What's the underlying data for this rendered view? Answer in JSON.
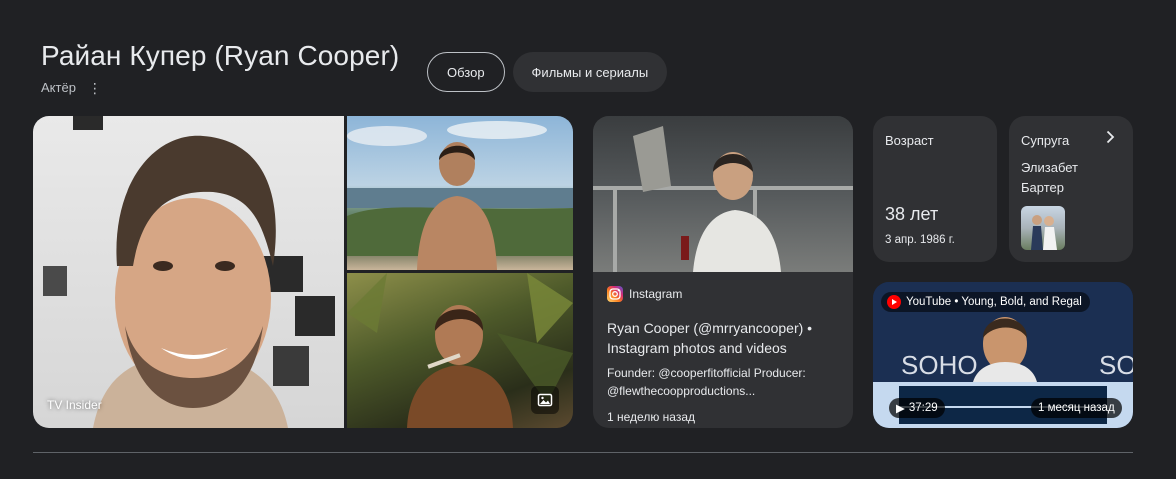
{
  "header": {
    "title": "Райан Купер (Ryan Cooper)",
    "subtitle": "Актёр",
    "more_icon": "more-vert-icon"
  },
  "tabs": [
    {
      "label": "Обзор",
      "active": true
    },
    {
      "label": "Фильмы и сериалы",
      "active": false
    }
  ],
  "photos": {
    "main_caption": "TV Insider",
    "images_icon": "image-icon"
  },
  "instagram": {
    "source": "Instagram",
    "title": "Ryan Cooper (@mrryancooper) • Instagram photos and videos",
    "description": "Founder: @cooperfitofficial Producer: @flewthecoopproductions...",
    "date": "1 неделю назад"
  },
  "facts": {
    "age": {
      "label": "Возраст",
      "value": "38 лет",
      "date": "3 апр. 1986 г."
    },
    "spouse": {
      "label": "Супруга",
      "name": "Элизабет Бартер",
      "icon": "chevron-right-icon"
    }
  },
  "video": {
    "source": "YouTube • Young, Bold, and Regal",
    "duration": "37:29",
    "age": "1 месяц назад"
  },
  "colors": {
    "background": "#202124",
    "card": "#303134",
    "text": "#e8eaed",
    "secondary_text": "#bdc1c6",
    "youtube_red": "#ff0000"
  }
}
